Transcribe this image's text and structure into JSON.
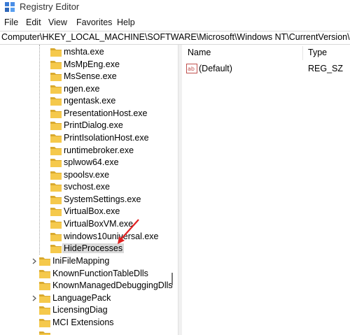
{
  "window": {
    "title": "Registry Editor",
    "icon": "registry-editor-icon"
  },
  "menu": [
    "File",
    "Edit",
    "View",
    "Favorites",
    "Help"
  ],
  "address": "Computer\\HKEY_LOCAL_MACHINE\\SOFTWARE\\Microsoft\\Windows NT\\CurrentVersion\\Image",
  "tree": {
    "children": [
      "mshta.exe",
      "MsMpEng.exe",
      "MsSense.exe",
      "ngen.exe",
      "ngentask.exe",
      "PresentationHost.exe",
      "PrintDialog.exe",
      "PrintIsolationHost.exe",
      "runtimebroker.exe",
      "splwow64.exe",
      "spoolsv.exe",
      "svchost.exe",
      "SystemSettings.exe",
      "VirtualBox.exe",
      "VirtualBoxVM.exe",
      "windows10universal.exe",
      "HideProcesses"
    ],
    "selected": "HideProcesses",
    "siblings": [
      {
        "label": "IniFileMapping",
        "expandable": true
      },
      {
        "label": "KnownFunctionTableDlls",
        "expandable": false
      },
      {
        "label": "KnownManagedDebuggingDlls",
        "expandable": false
      },
      {
        "label": "LanguagePack",
        "expandable": true
      },
      {
        "label": "LicensingDiag",
        "expandable": false
      },
      {
        "label": "MCI Extensions",
        "expandable": false
      }
    ]
  },
  "list": {
    "columns": {
      "name": "Name",
      "type": "Type"
    },
    "rows": [
      {
        "name": "(Default)",
        "type": "REG_SZ",
        "icon": "string-value-icon"
      }
    ]
  },
  "colors": {
    "folder": "#f5c94c",
    "folder_dark": "#d9a92e",
    "annotation_arrow": "#e02020",
    "selection": "#d9d9d9"
  },
  "annotation": "red-arrow-pointing-to-selected-key"
}
